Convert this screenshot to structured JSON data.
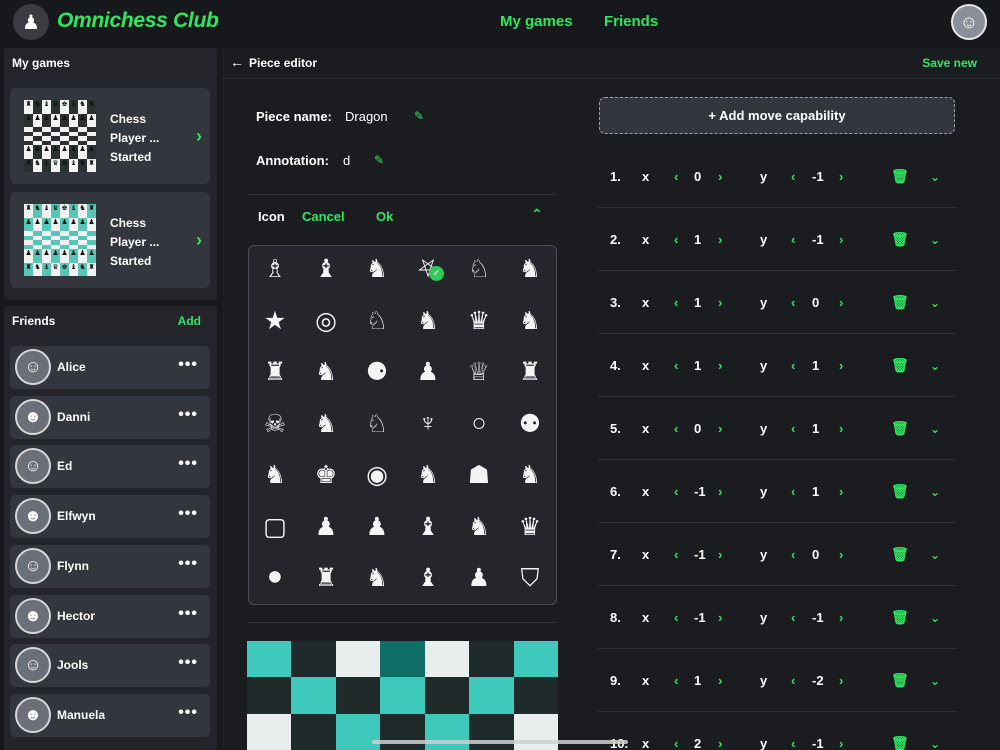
{
  "header": {
    "brand": "Omnichess Club",
    "nav": [
      {
        "label": "My games"
      },
      {
        "label": "Friends"
      }
    ],
    "logo_icon": "chess-pieces-icon",
    "profile_icon": "user-avatar-icon"
  },
  "sidebar": {
    "games_title": "My games",
    "games": [
      {
        "line1": "Chess",
        "line2": "Player ...",
        "line3": "Started"
      },
      {
        "line1": "Chess",
        "line2": "Player ...",
        "line3": "Started"
      }
    ],
    "friends_title": "Friends",
    "friends_add": "Add",
    "friends": [
      {
        "name": "Alice",
        "more": "•••"
      },
      {
        "name": "Danni",
        "more": "•••"
      },
      {
        "name": "Ed",
        "more": "•••"
      },
      {
        "name": "Elfwyn",
        "more": "•••"
      },
      {
        "name": "Flynn",
        "more": "•••"
      },
      {
        "name": "Hector",
        "more": "•••"
      },
      {
        "name": "Jools",
        "more": "•••"
      },
      {
        "name": "Manuela",
        "more": "•••"
      }
    ]
  },
  "editor": {
    "back_icon": "arrow-left-icon",
    "title": "Piece editor",
    "save_new": "Save new",
    "piece_name_label": "Piece name:",
    "piece_name_value": "Dragon",
    "annotation_label": "Annotation:",
    "annotation_value": "d",
    "icon_label": "Icon",
    "icon_cancel": "Cancel",
    "icon_ok": "Ok",
    "selected_icon_index": 3
  },
  "moves": {
    "add_label": "+ Add move capability",
    "rows": [
      {
        "n": "1.",
        "x": "0",
        "y": "-1"
      },
      {
        "n": "2.",
        "x": "1",
        "y": "-1"
      },
      {
        "n": "3.",
        "x": "1",
        "y": "0"
      },
      {
        "n": "4.",
        "x": "1",
        "y": "1"
      },
      {
        "n": "5.",
        "x": "0",
        "y": "1"
      },
      {
        "n": "6.",
        "x": "-1",
        "y": "1"
      },
      {
        "n": "7.",
        "x": "-1",
        "y": "0"
      },
      {
        "n": "8.",
        "x": "-1",
        "y": "-1"
      },
      {
        "n": "9.",
        "x": "1",
        "y": "-2"
      },
      {
        "n": "10.",
        "x": "2",
        "y": "-1"
      }
    ],
    "x_label": "x",
    "y_label": "y"
  },
  "colors": {
    "accent": "#2ee660",
    "board_light": "#3fc9bc",
    "board_dark": "#1f2a2a",
    "board_white": "#e8eded",
    "board_teal_dark": "#0f6e66"
  }
}
